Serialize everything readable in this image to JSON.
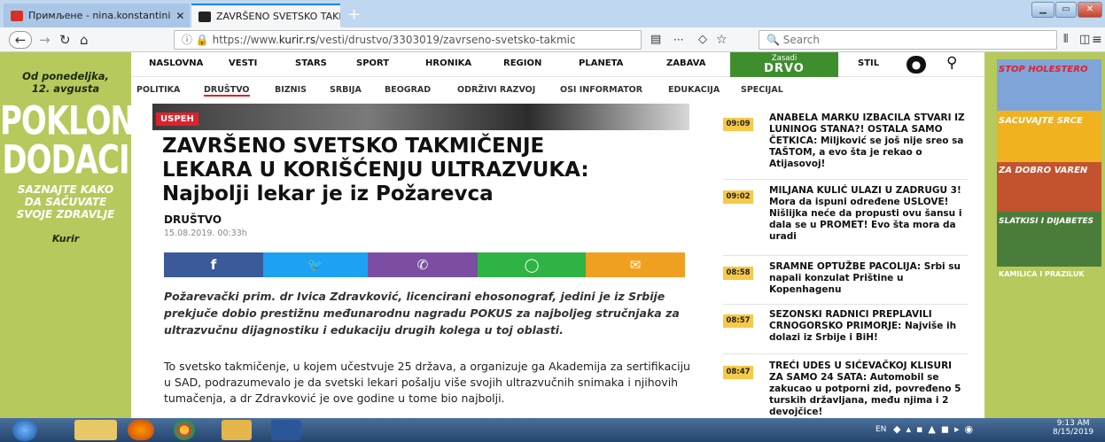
{
  "browser": {
    "tabs": [
      {
        "label": "Примљене - nina.konstantini",
        "active": false
      },
      {
        "label": "ZAVRŠENO SVETSKO TAKMIČE",
        "active": true
      }
    ],
    "url_prefix": "https://www.",
    "url_host": "kurir.rs",
    "url_path": "/vesti/drustvo/3303019/zavrseno-svetsko-takmic",
    "search_placeholder": "Search",
    "url_menu": "···"
  },
  "left_ad": {
    "date_line1": "Od ponedeljka,",
    "date_line2": "12. avgusta",
    "big1": "POKLON",
    "big2": "DODACI",
    "cta1": "SAZNAJTE KAKO",
    "cta2": "DA SAČUVATE",
    "cta3": "SVOJE ZDRAVLJE",
    "brand": "Kurir"
  },
  "right_ad": {
    "lines": [
      "STOP HOLESTERO",
      "SAČUVAJTE SRCE",
      "ZA DOBRO VAREN",
      "SLATKIŠI I DIJABETES",
      "KAMILICA I PRAZILUK"
    ]
  },
  "main_nav": {
    "items": [
      "NASLOVNA",
      "VESTI",
      "STARS",
      "SPORT",
      "HRONIKA",
      "REGION",
      "PLANETA",
      "ZABAVA",
      "STIL"
    ],
    "promo_line1": "Zasadi",
    "promo_line2": "DRVO"
  },
  "sub_nav": {
    "items": [
      "POLITIKA",
      "DRUŠTVO",
      "BIZNIS",
      "SRBIJA",
      "BEOGRAD",
      "ODRŽIVI RAZVOJ",
      "OSI INFORMATOR",
      "EDUKACIJA",
      "SPECIJAL"
    ]
  },
  "article": {
    "label": "USPEH",
    "headline_l1": "ZAVRŠENO SVETSKO TAKMIČENJE",
    "headline_l2": "LEKARA U KORIŠĆENJU ULTRAZVUKA:",
    "headline_l3": "Najbolji lekar je iz Požarevca",
    "category": "DRUŠTVO",
    "date": "15.08.2019. 00:33h",
    "lead": "Požarevački prim. dr Ivica Zdravković, licencirani ehosonograf, jedini je iz Srbije prekjuče dobio prestižnu međunarodnu nagradu POKUS za najboljeg stručnjaka za ultrazvučnu dijagnostiku i edukaciju drugih kolega u toj oblasti.",
    "body": "To svetsko takmičenje, u kojem učestvuje 25 država, a organizuje ga Akademija za sertifikaciju u SAD, podrazumevalo je da svetski lekari pošalju više svojih ultrazvučnih snimaka i njihovih tumačenja, a dr Zdravković je ove godine u tome bio najbolji."
  },
  "share": {
    "colors": [
      "#3b5a9a",
      "#1da1f2",
      "#7b4ea3",
      "#2fb344",
      "#f0a020"
    ],
    "icons": [
      "f",
      "🐦",
      "✆",
      "✆",
      "✉"
    ]
  },
  "news": [
    {
      "time": "09:09",
      "title": "ANABELA MARKU IZBACILA STVARI IZ LUNINOG STANA?! OSTALA SAMO ČETKICA: Miljković se još nije sreo sa TAŠTOM, a evo šta je rekao o Atijasovoj!"
    },
    {
      "time": "09:02",
      "title": "MILJANA KULIĆ ULAZI U ZADRUGU 3! Mora da ispuni određene USLOVE! Nišlijka neće da propusti ovu šansu i dala se u PROMET! Evo šta mora da uradi"
    },
    {
      "time": "08:58",
      "title": "SRAMNE OPTUŽBE PACOLIJA: Srbi su napali konzulat Prištine u Kopenhagenu"
    },
    {
      "time": "08:57",
      "title": "SEZONSKI RADNICI PREPLAVILI CRNOGORSKO PRIMORJE: Najviše ih dolazi iz Srbije i BiH!"
    },
    {
      "time": "08:47",
      "title": "TREĆI UDES U SIĆEVAČKOJ KLISURI ZA SAMO 24 SATA: Automobil se zakucao u potporni zid, povređeno 5 turskih državljana, među njima i 2 devojčice!"
    }
  ],
  "taskbar": {
    "lang": "EN",
    "time": "9:13 AM",
    "date": "8/15/2019"
  }
}
